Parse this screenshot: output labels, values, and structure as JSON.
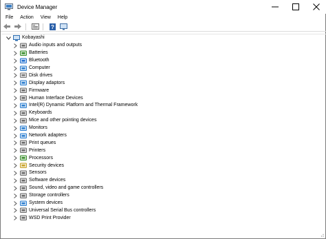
{
  "window": {
    "title": "Device Manager",
    "controls": [
      "minimize-icon",
      "maximize-icon",
      "close-icon"
    ]
  },
  "menu": [
    "File",
    "Action",
    "View",
    "Help"
  ],
  "toolbar": [
    "back-arrow-icon",
    "forward-arrow-icon",
    "properties-icon",
    "help-icon",
    "display-icon"
  ],
  "tree": {
    "root": {
      "label": "Kobayashi",
      "icon": "computer-icon",
      "expanded": true
    },
    "items": [
      {
        "label": "Audio inputs and outputs",
        "icon": "speaker-icon",
        "color": "#6b6b6b"
      },
      {
        "label": "Batteries",
        "icon": "battery-icon",
        "color": "#3a8f2c"
      },
      {
        "label": "Bluetooth",
        "icon": "bluetooth-icon",
        "color": "#1f6fcf"
      },
      {
        "label": "Computer",
        "icon": "computer-icon",
        "color": "#2d7fd0"
      },
      {
        "label": "Disk drives",
        "icon": "disk-drive-icon",
        "color": "#7a7a7a"
      },
      {
        "label": "Display adaptors",
        "icon": "display-adapter-icon",
        "color": "#2d7fd0"
      },
      {
        "label": "Firmware",
        "icon": "firmware-icon",
        "color": "#6b6b6b"
      },
      {
        "label": "Human Interface Devices",
        "icon": "hid-icon",
        "color": "#6b6b6b"
      },
      {
        "label": "Intel(R) Dynamic Platform and Thermal Framework",
        "icon": "chip-icon",
        "color": "#2d7fd0"
      },
      {
        "label": "Keyboards",
        "icon": "keyboard-icon",
        "color": "#6b6b6b"
      },
      {
        "label": "Mice and other pointing devices",
        "icon": "mouse-icon",
        "color": "#6b6b6b"
      },
      {
        "label": "Monitors",
        "icon": "monitor-icon",
        "color": "#2d7fd0"
      },
      {
        "label": "Network adapters",
        "icon": "network-icon",
        "color": "#2d7fd0"
      },
      {
        "label": "Print queues",
        "icon": "print-queue-icon",
        "color": "#6b6b6b"
      },
      {
        "label": "Printers",
        "icon": "printer-icon",
        "color": "#6b6b6b"
      },
      {
        "label": "Processors",
        "icon": "processor-icon",
        "color": "#3a8f2c"
      },
      {
        "label": "Security devices",
        "icon": "security-icon",
        "color": "#c9a227"
      },
      {
        "label": "Sensors",
        "icon": "sensor-icon",
        "color": "#6b6b6b"
      },
      {
        "label": "Software devices",
        "icon": "software-icon",
        "color": "#6b6b6b"
      },
      {
        "label": "Sound, video and game controllers",
        "icon": "sound-icon",
        "color": "#6b6b6b"
      },
      {
        "label": "Storage controllers",
        "icon": "storage-icon",
        "color": "#6b6b6b"
      },
      {
        "label": "System devices",
        "icon": "system-icon",
        "color": "#2d7fd0"
      },
      {
        "label": "Universal Serial Bus controllers",
        "icon": "usb-icon",
        "color": "#6b6b6b"
      },
      {
        "label": "WSD Print Provider",
        "icon": "wsd-printer-icon",
        "color": "#6b6b6b"
      }
    ]
  }
}
